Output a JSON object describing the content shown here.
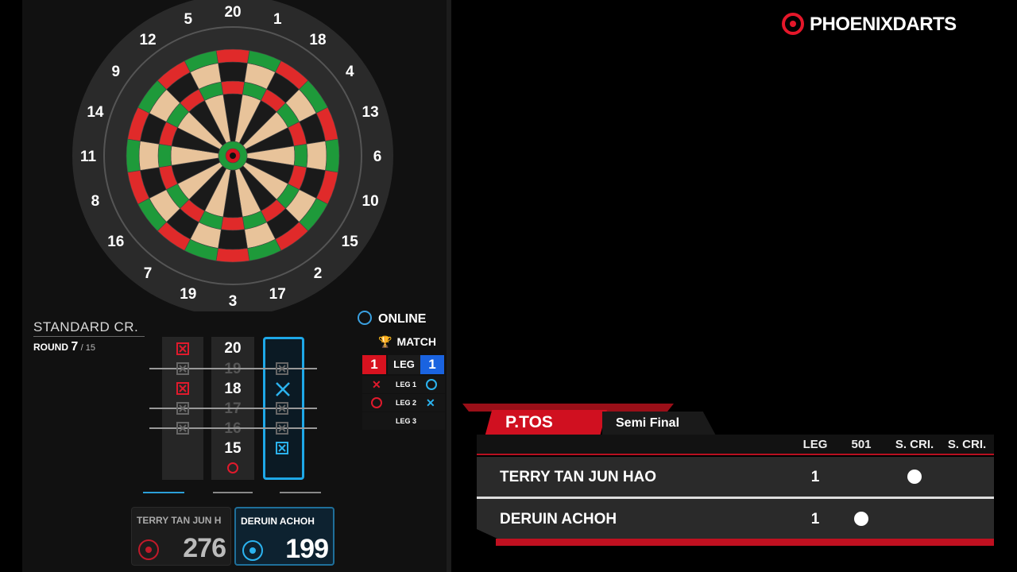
{
  "board": {
    "numbers": [
      "20",
      "1",
      "18",
      "4",
      "13",
      "6",
      "10",
      "15",
      "2",
      "17",
      "3",
      "19",
      "7",
      "16",
      "8",
      "11",
      "14",
      "9",
      "12",
      "5"
    ],
    "colors": {
      "black": "#1a1a1a",
      "cream": "#e8c39a",
      "red": "#e02a2a",
      "green": "#1e9a3a",
      "bull_red": "#d8121f",
      "surround": "#2c2c2c"
    }
  },
  "game": {
    "mode": "STANDARD CR.",
    "round_label": "ROUND",
    "round_current": "7",
    "round_total": "/ 15",
    "targets": [
      {
        "number": "20",
        "closed": false
      },
      {
        "number": "19",
        "closed": true
      },
      {
        "number": "18",
        "closed": false
      },
      {
        "number": "17",
        "closed": true
      },
      {
        "number": "16",
        "closed": true
      },
      {
        "number": "15",
        "closed": false
      },
      {
        "number": "BULL",
        "closed": false
      }
    ]
  },
  "match": {
    "online_label": "ONLINE",
    "match_label": "MATCH",
    "leg_label": "LEG",
    "left_legs": "1",
    "right_legs": "1",
    "legs": [
      {
        "label": "LEG 1",
        "left": "loss",
        "right": "win"
      },
      {
        "label": "LEG 2",
        "left": "win",
        "right": "loss"
      },
      {
        "label": "LEG 3",
        "left": "",
        "right": ""
      }
    ]
  },
  "players": [
    {
      "name": "TERRY TAN JUN H",
      "score": "276",
      "accent": "#c01a2a",
      "active": false
    },
    {
      "name": "DERUIN ACHOH",
      "score": "199",
      "accent": "#2bb3ef",
      "active": true
    }
  ],
  "brand": {
    "name": "PHOENIXDARTS",
    "accent": "#e5172a"
  },
  "scoreboard": {
    "event": "P.TOS",
    "stage": "Semi Final",
    "columns": [
      "LEG",
      "501",
      "S. CRI.",
      "S. CRI."
    ],
    "rows": [
      {
        "name": "TERRY TAN JUN HAO",
        "legs": "1",
        "won_game": "S. CRI."
      },
      {
        "name": "DERUIN ACHOH",
        "legs": "1",
        "won_game": "501"
      }
    ]
  }
}
